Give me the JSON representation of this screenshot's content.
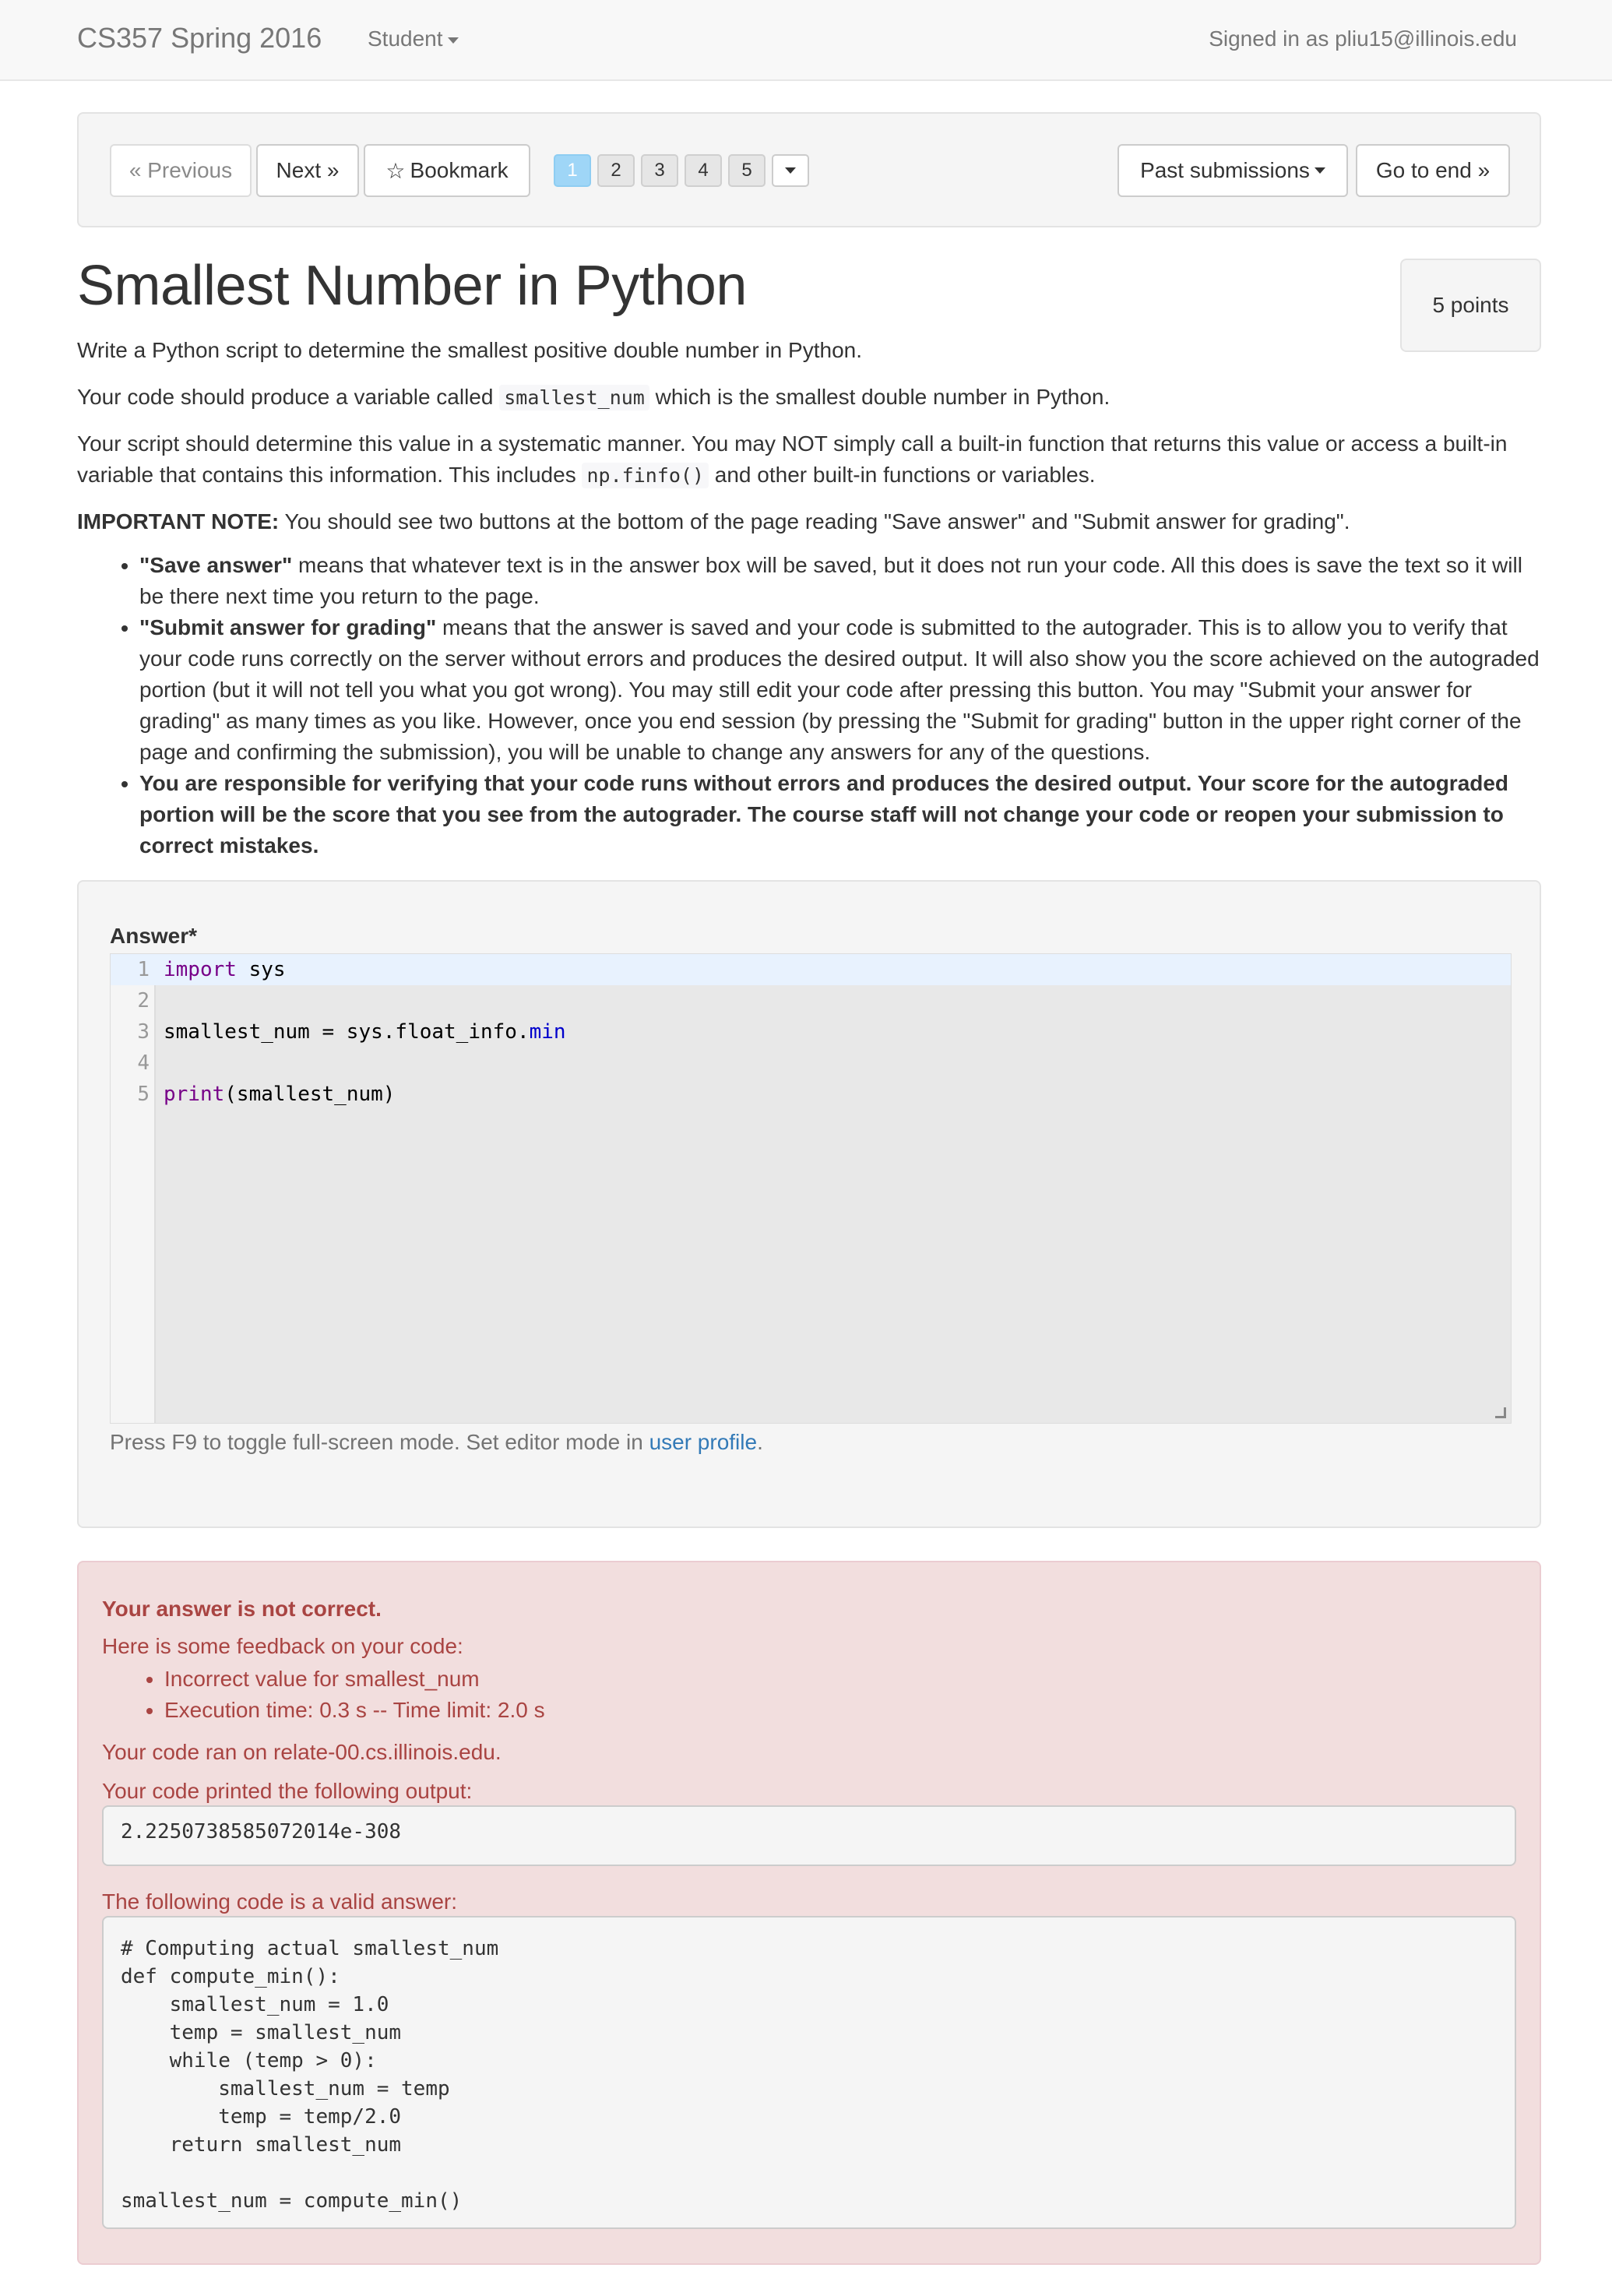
{
  "navbar": {
    "brand": "CS357 Spring 2016",
    "student_menu": "Student",
    "signed_in": "Signed in as pliu15@illinois.edu"
  },
  "toolbar": {
    "previous": "« Previous",
    "next": "Next »",
    "bookmark_icon": "☆",
    "bookmark": "Bookmark",
    "pages": [
      "1",
      "2",
      "3",
      "4",
      "5"
    ],
    "active_page": "1",
    "past_submissions": "Past submissions",
    "go_to_end": "Go to end »"
  },
  "question": {
    "title": "Smallest Number in Python",
    "points": "5 points",
    "p1": "Write a Python script to determine the smallest positive double number in Python.",
    "p2_before": "Your code should produce a variable called ",
    "p2_code": "smallest_num",
    "p2_after": " which is the smallest double number in Python.",
    "p3_before": "Your script should determine this value in a systematic manner. You may NOT simply call a built-in function that returns this value or access a built-in variable that contains this information. This includes ",
    "p3_code": "np.finfo()",
    "p3_after": " and other built-in functions or variables.",
    "note_label": "IMPORTANT NOTE:",
    "note_text": " You should see two buttons at the bottom of the page reading \"Save answer\" and \"Submit answer for grading\".",
    "bullets": [
      {
        "strong": "\"Save answer\"",
        "text": " means that whatever text is in the answer box will be saved, but it does not run your code. All this does is save the text so it will be there next time you return to the page."
      },
      {
        "strong": "\"Submit answer for grading\"",
        "text": " means that the answer is saved and your code is submitted to the autograder. This is to allow you to verify that your code runs correctly on the server without errors and produces the desired output. It will also show you the score achieved on the autograded portion (but it will not tell you what you got wrong). You may still edit your code after pressing this button. You may \"Submit your answer for grading\" as many times as you like. However, once you end session (by pressing the \"Submit for grading\" button in the upper right corner of the page and confirming the submission), you will be unable to change any answers for any of the questions."
      },
      {
        "strong": "You are responsible for verifying that your code runs without errors and produces the desired output. Your score for the autograded portion will be the score that you see from the autograder. The course staff will not change your code or reopen your submission to correct mistakes.",
        "text": ""
      }
    ]
  },
  "answer": {
    "label": "Answer*",
    "lines": [
      {
        "num": "1",
        "kw": "import",
        "rest": " sys",
        "prop": "",
        "tail": ""
      },
      {
        "num": "2",
        "kw": "",
        "rest": "",
        "prop": "",
        "tail": ""
      },
      {
        "num": "3",
        "kw": "",
        "rest": "smallest_num = sys.float_info.",
        "prop": "min",
        "tail": ""
      },
      {
        "num": "4",
        "kw": "",
        "rest": "",
        "prop": "",
        "tail": ""
      },
      {
        "num": "5",
        "kw": "print",
        "rest": "(smallest_num)",
        "prop": "",
        "tail": ""
      }
    ],
    "help_before": "Press F9 to toggle full-screen mode. Set editor mode in ",
    "help_link": "user profile",
    "help_after": "."
  },
  "feedback": {
    "heading": "Your answer is not correct.",
    "intro": "Here is some feedback on your code:",
    "items": [
      "Incorrect value for smallest_num",
      "Execution time: 0.3 s -- Time limit: 2.0 s"
    ],
    "ran_on": "Your code ran on relate-00.cs.illinois.edu.",
    "printed_label": "Your code printed the following output:",
    "output": "2.2250738585072014e-308",
    "valid_label": "The following code is a valid answer:",
    "valid_code": "# Computing actual smallest_num\ndef compute_min():\n    smallest_num = 1.0\n    temp = smallest_num\n    while (temp > 0):\n        smallest_num = temp\n        temp = temp/2.0\n    return smallest_num\n\nsmallest_num = compute_min()"
  },
  "colors": {
    "alert_text": "#a94442",
    "alert_bg": "#f2dede",
    "active_page": "#9fd6f7",
    "keyword": "#770088",
    "link": "#337ab7"
  }
}
